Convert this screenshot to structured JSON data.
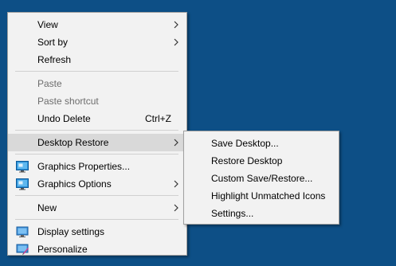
{
  "context_menu": {
    "view": "View",
    "sort_by": "Sort by",
    "refresh": "Refresh",
    "paste": "Paste",
    "paste_shortcut": "Paste shortcut",
    "undo_delete": "Undo Delete",
    "undo_delete_shortcut": "Ctrl+Z",
    "desktop_restore": "Desktop Restore",
    "graphics_properties": "Graphics Properties...",
    "graphics_options": "Graphics Options",
    "new": "New",
    "display_settings": "Display settings",
    "personalize": "Personalize"
  },
  "submenu": {
    "save_desktop": "Save Desktop...",
    "restore_desktop": "Restore Desktop",
    "custom_save_restore": "Custom Save/Restore...",
    "highlight_unmatched": "Highlight Unmatched Icons",
    "settings": "Settings..."
  },
  "icons": {
    "graphics_properties": "intel-graphics-icon",
    "graphics_options": "intel-graphics-icon",
    "display_settings": "display-icon",
    "personalize": "personalize-icon"
  },
  "colors": {
    "desktop_background": "#0d4f86",
    "menu_background": "#f2f2f2",
    "highlight": "#d9d9d9",
    "disabled_text": "#6d6d6d"
  }
}
